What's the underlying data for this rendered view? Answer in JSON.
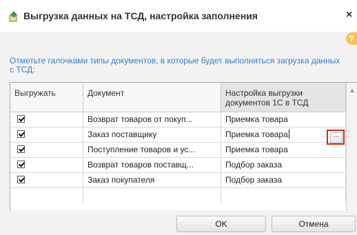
{
  "window": {
    "title": "Выгрузка данных на ТСД, настройка заполнения",
    "close_label": "×",
    "help_label": "?"
  },
  "instruction": "Отметьте галочками типы документов, в которые будет выполняться загрузка данных с ТСД:",
  "grid": {
    "columns": [
      "Выгружать",
      "Документ",
      "Настройка выгрузки документов 1С в ТСД"
    ],
    "rows": [
      {
        "checked": true,
        "document": "Возврат товаров от покуп...",
        "setting": "Приемка товара"
      },
      {
        "checked": true,
        "document": "Заказ поставщику",
        "setting": "Приемка товара"
      },
      {
        "checked": true,
        "document": "Поступление товаров и ус...",
        "setting": "Приемка товара"
      },
      {
        "checked": true,
        "document": "Возврат товаров поставщ...",
        "setting": "Подбор заказа"
      },
      {
        "checked": true,
        "document": "Заказ покупателя",
        "setting": "Подбор заказа"
      }
    ],
    "ellipsis_label": "..."
  },
  "buttons": {
    "ok_label": "OK",
    "cancel_label": "Отмена"
  },
  "colors": {
    "instruction": "#3a7bd5",
    "highlight": "#d9251c"
  }
}
